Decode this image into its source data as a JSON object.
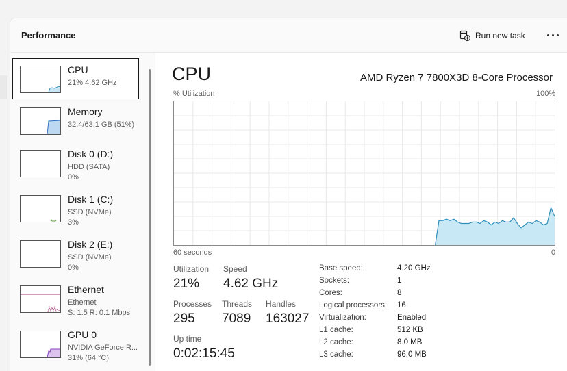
{
  "header": {
    "title": "Performance",
    "run_new_task": "Run new task"
  },
  "sidebar": {
    "items": [
      {
        "name": "CPU",
        "line1": "21%  4.62 GHz",
        "line2": ""
      },
      {
        "name": "Memory",
        "line1": "32.4/63.1 GB (51%)",
        "line2": ""
      },
      {
        "name": "Disk 0 (D:)",
        "line1": "HDD (SATA)",
        "line2": "0%"
      },
      {
        "name": "Disk 1 (C:)",
        "line1": "SSD (NVMe)",
        "line2": "3%"
      },
      {
        "name": "Disk 2 (E:)",
        "line1": "SSD (NVMe)",
        "line2": "0%"
      },
      {
        "name": "Ethernet",
        "line1": "Ethernet",
        "line2": "S: 1.5  R: 0.1 Mbps"
      },
      {
        "name": "GPU 0",
        "line1": "NVIDIA GeForce R...",
        "line2": "31% (64 °C)"
      }
    ]
  },
  "main": {
    "title": "CPU",
    "model": "AMD Ryzen 7 7800X3D 8-Core Processor",
    "graph": {
      "y_label": "% Utilization",
      "y_max_label": "100%",
      "x_left_label": "60 seconds",
      "x_right_label": "0",
      "utilization_history": [
        0,
        0,
        0,
        0,
        0,
        0,
        0,
        0,
        0,
        0,
        0,
        0,
        0,
        0,
        0,
        0,
        0,
        0,
        0,
        0,
        0,
        0,
        0,
        0,
        0,
        0,
        0,
        0,
        0,
        0,
        0,
        0,
        0,
        0,
        0,
        0,
        0,
        0,
        0,
        0,
        0,
        0,
        0,
        0,
        0,
        0,
        0,
        0,
        0,
        0,
        0,
        0,
        0,
        0,
        0,
        0,
        0,
        0,
        0,
        0,
        0,
        0,
        0,
        0,
        0,
        0,
        0,
        0,
        0,
        0,
        0,
        17,
        17,
        18,
        17,
        18,
        16,
        15,
        15,
        15,
        16,
        16,
        15,
        17,
        16,
        14,
        16,
        15,
        17,
        16,
        16,
        19,
        15,
        12,
        14,
        16,
        15,
        17,
        16,
        14,
        15,
        26,
        20
      ]
    },
    "stats": {
      "utilization_label": "Utilization",
      "utilization": "21%",
      "speed_label": "Speed",
      "speed": "4.62 GHz",
      "processes_label": "Processes",
      "processes": "295",
      "threads_label": "Threads",
      "threads": "7089",
      "handles_label": "Handles",
      "handles": "163027",
      "uptime_label": "Up time",
      "uptime": "0:02:15:45"
    },
    "specs": [
      {
        "label": "Base speed:",
        "value": "4.20 GHz"
      },
      {
        "label": "Sockets:",
        "value": "1"
      },
      {
        "label": "Cores:",
        "value": "8"
      },
      {
        "label": "Logical processors:",
        "value": "16"
      },
      {
        "label": "Virtualization:",
        "value": "Enabled"
      },
      {
        "label": "L1 cache:",
        "value": "512 KB"
      },
      {
        "label": "L2 cache:",
        "value": "8.0 MB"
      },
      {
        "label": "L3 cache:",
        "value": "96.0 MB"
      }
    ]
  },
  "colors": {
    "cpu_line": "#2f8fb9",
    "cpu_fill": "#c8e8f6",
    "memory_line": "#2f6fbf",
    "memory_fill": "#bcd8f2",
    "ethernet_line": "#a03b7a",
    "gpu_line": "#8a3fbf",
    "gpu_fill": "#dcc4ef",
    "grid": "#e8e8e8"
  }
}
